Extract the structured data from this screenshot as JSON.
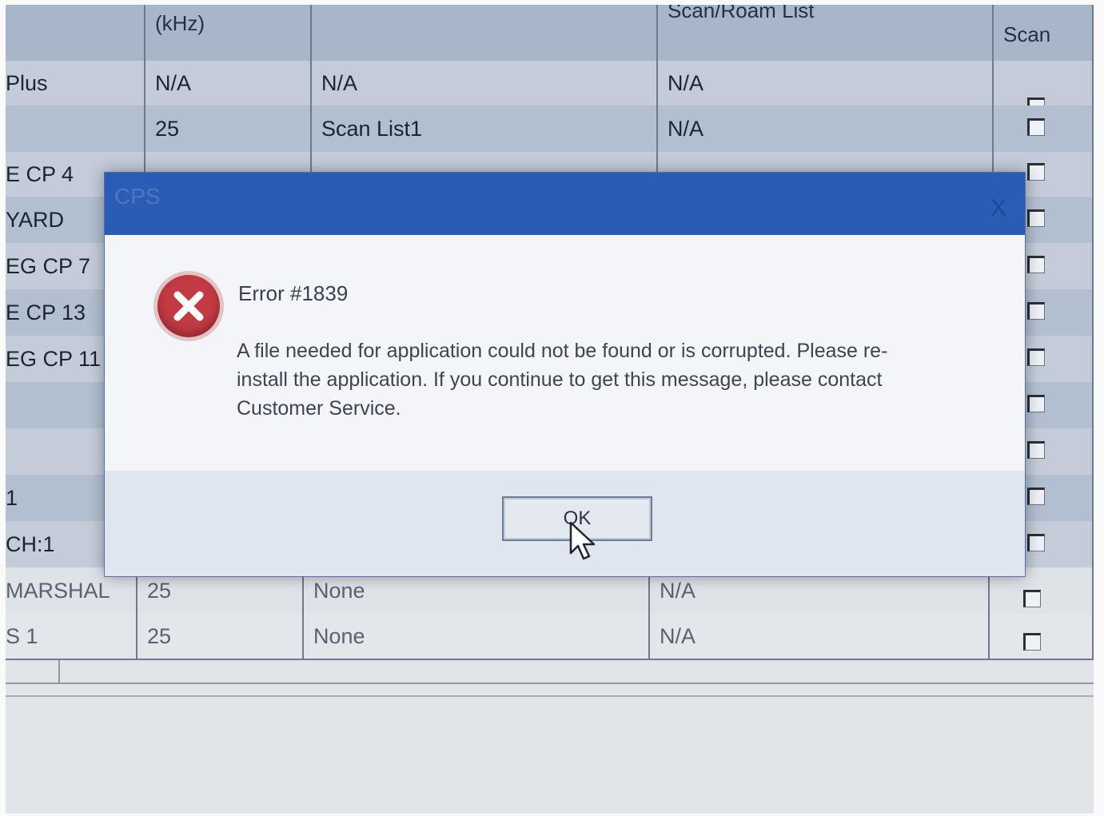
{
  "table": {
    "headers": {
      "bw": "(kHz)",
      "scan_roam": "Scan/Roam List",
      "auto_scan": "Scan"
    },
    "rows": [
      {
        "name": "Plus",
        "bw": "N/A",
        "list": "N/A",
        "roam": "N/A"
      },
      {
        "name": "",
        "bw": "25",
        "list": "Scan List1",
        "roam": "N/A"
      },
      {
        "name": "E CP 4",
        "bw": "",
        "list": "",
        "roam": ""
      },
      {
        "name": "YARD",
        "bw": "",
        "list": "",
        "roam": ""
      },
      {
        "name": "EG CP 7",
        "bw": "",
        "list": "",
        "roam": ""
      },
      {
        "name": "E CP 13",
        "bw": "",
        "list": "",
        "roam": ""
      },
      {
        "name": "EG CP 11",
        "bw": "",
        "list": "",
        "roam": ""
      },
      {
        "name": "",
        "bw": "",
        "list": "",
        "roam": ""
      },
      {
        "name": "",
        "bw": "",
        "list": "",
        "roam": ""
      },
      {
        "name": "1",
        "bw": "",
        "list": "",
        "roam": ""
      },
      {
        "name": "CH:1",
        "bw": "",
        "list": "",
        "roam": ""
      },
      {
        "name": "MARSHAL",
        "bw": "25",
        "list": "None",
        "roam": "N/A"
      },
      {
        "name": "S 1",
        "bw": "25",
        "list": "None",
        "roam": "N/A"
      }
    ]
  },
  "dialog": {
    "title": "CPS",
    "close": "X",
    "error_title": "Error #1839",
    "message": "A file needed for application could not be found or is corrupted.  Please re-install the application.  If you continue to get this message, please contact Customer Service.",
    "ok_label": "OK"
  },
  "icons": {
    "error": "error-x-icon",
    "cursor": "mouse-pointer-icon"
  }
}
